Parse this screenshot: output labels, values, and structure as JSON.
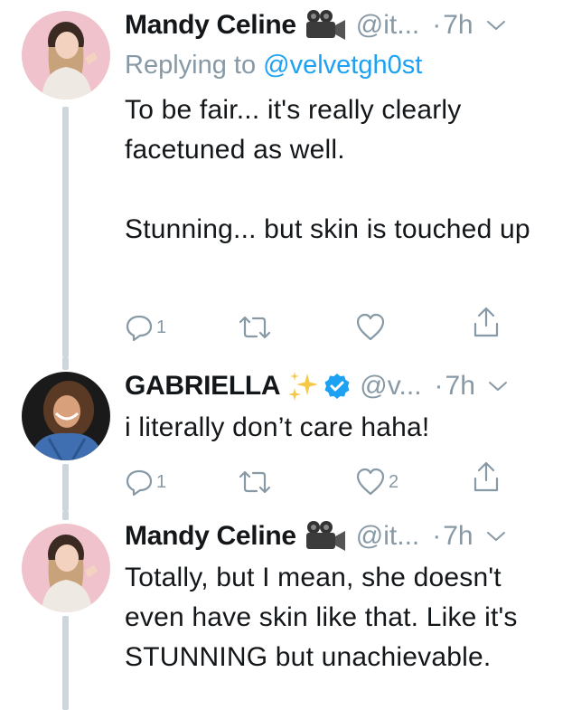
{
  "tweets": [
    {
      "name": "Mandy Celine",
      "handle": "@it...",
      "dot": "·",
      "time": "7h",
      "emoji": "movie-camera-icon",
      "replying_to_prefix": "Replying to ",
      "replying_to_handle": "@velvetgh0st",
      "text": "To be fair... it's really clearly facetuned as well.\n\nStunning... but skin is touched up",
      "replies": "1",
      "retweets": "",
      "likes": ""
    },
    {
      "name": "GABRIELLA",
      "handle": "@v...",
      "dot": "·",
      "time": "7h",
      "emoji": "sparkles-icon",
      "verified": true,
      "text": "i literally don’t care haha!",
      "replies": "1",
      "retweets": "",
      "likes": "2"
    },
    {
      "name": "Mandy Celine",
      "handle": "@it...",
      "dot": "·",
      "time": "7h",
      "emoji": "movie-camera-icon",
      "text": "Totally, but I mean, she doesn't even have skin like that. Like it's STUNNING but unachievable.",
      "replies": "",
      "retweets": "",
      "likes": ""
    }
  ],
  "colors": {
    "secondary_text": "#8899a6",
    "link": "#1da1f2",
    "thread_line": "#ccd6dd",
    "verified": "#1da1f2",
    "avatar_pink_bg": "#f0c2cc"
  }
}
